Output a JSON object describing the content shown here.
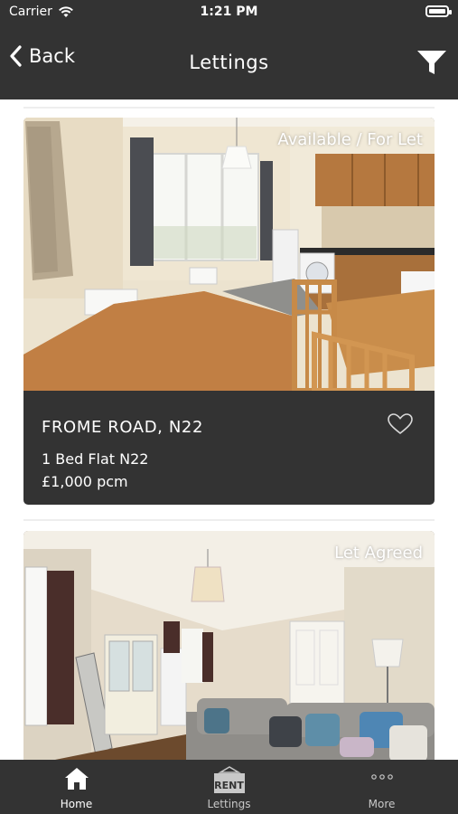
{
  "status_bar": {
    "carrier": "Carrier",
    "time": "1:21 PM"
  },
  "nav": {
    "back_label": "Back",
    "title": "Lettings",
    "filter_icon": "filter-icon"
  },
  "listings": [
    {
      "status": "Available / For Let",
      "address": "FROME ROAD, N22",
      "type": "1 Bed Flat N22",
      "price": "£1,000 pcm"
    },
    {
      "status": "Let Agreed"
    }
  ],
  "tabbar": {
    "items": [
      {
        "label": "Home",
        "icon": "home-icon"
      },
      {
        "label": "Lettings",
        "icon": "rent-sign-icon",
        "icon_text": "RENT"
      },
      {
        "label": "More",
        "icon": "more-icon"
      }
    ]
  },
  "colors": {
    "bar": "#333333",
    "text": "#ffffff"
  }
}
